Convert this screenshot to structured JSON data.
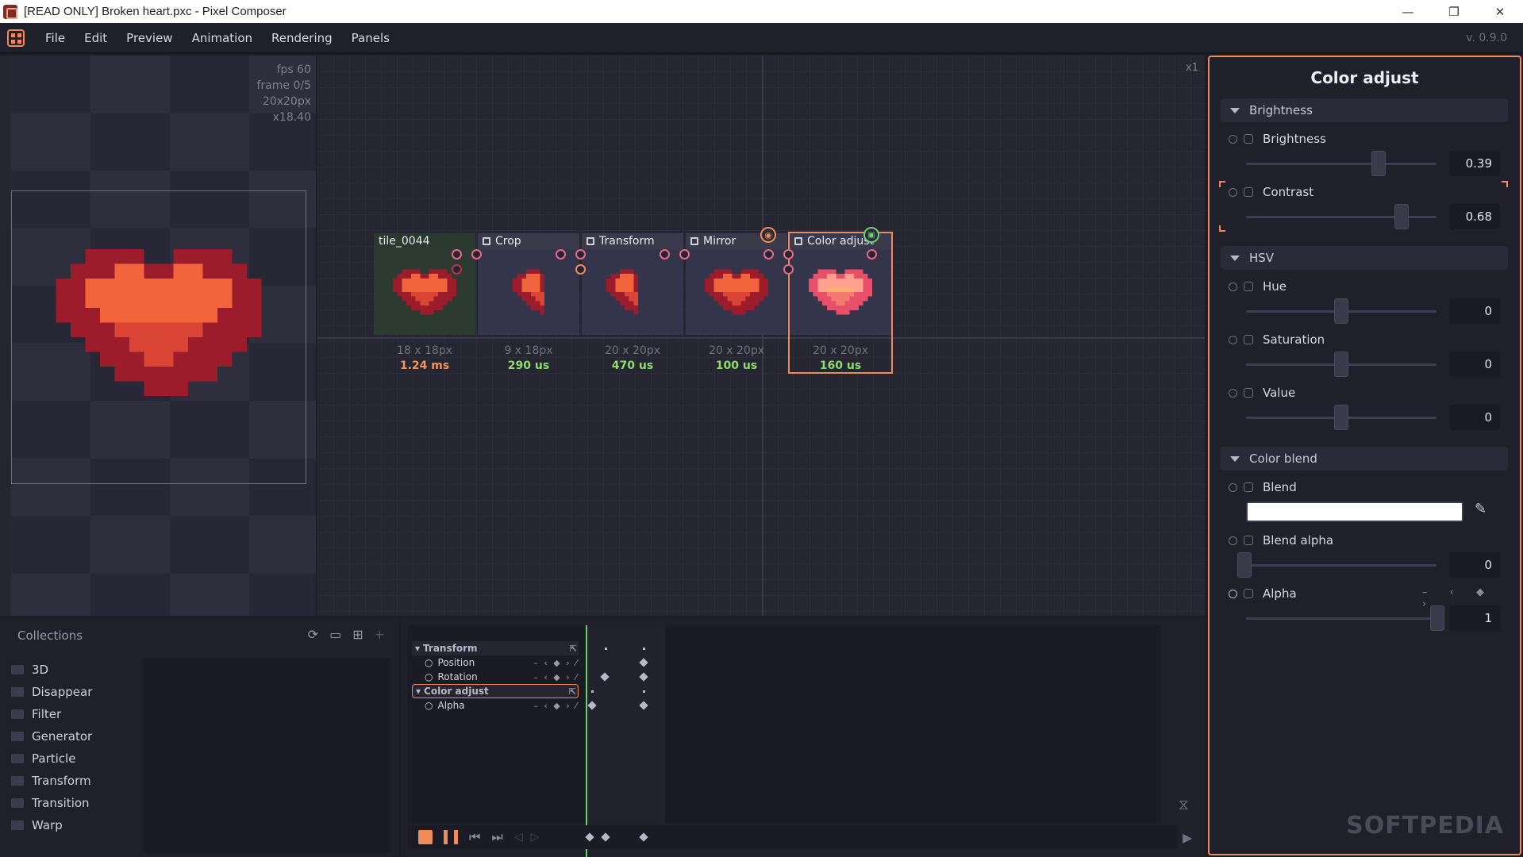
{
  "window": {
    "title": "[READ ONLY] Broken heart.pxc - Pixel Composer",
    "minimize": "—",
    "maximize": "❐",
    "close": "✕"
  },
  "menu": {
    "items": [
      "File",
      "Edit",
      "Preview",
      "Animation",
      "Rendering",
      "Panels"
    ],
    "version": "v. 0.9.0"
  },
  "preview": {
    "fps": "fps 60",
    "frame": "frame 0/5",
    "size": "20x20px",
    "zoom": "x18.40"
  },
  "graph": {
    "zoom": "x1",
    "nodes": [
      {
        "name": "tile_0044",
        "size": "18 x 18px",
        "time": "1.24 ms",
        "time_color": "#f2955a"
      },
      {
        "name": "Crop",
        "size": "9 x 18px",
        "time": "290 us",
        "time_color": "#8fdc6a"
      },
      {
        "name": "Transform",
        "size": "20 x 20px",
        "time": "470 us",
        "time_color": "#8fdc6a"
      },
      {
        "name": "Mirror",
        "size": "20 x 20px",
        "time": "100 us",
        "time_color": "#8fdc6a"
      },
      {
        "name": "Color adjust",
        "size": "20 x 20px",
        "time": "160 us",
        "time_color": "#8fdc6a"
      }
    ]
  },
  "collections": {
    "title": "Collections",
    "items": [
      "3D",
      "Disappear",
      "Filter",
      "Generator",
      "Particle",
      "Transform",
      "Transition",
      "Warp"
    ]
  },
  "timeline": {
    "rows": [
      {
        "label": "Transform",
        "type": "group"
      },
      {
        "label": "Position",
        "type": "prop"
      },
      {
        "label": "Rotation",
        "type": "prop"
      },
      {
        "label": "Color adjust",
        "type": "group"
      },
      {
        "label": "Alpha",
        "type": "prop"
      }
    ]
  },
  "inspector": {
    "title": "Color adjust",
    "sections": [
      "Brightness",
      "HSV",
      "Color blend"
    ],
    "props": {
      "brightness": {
        "label": "Brightness",
        "value": "0.39"
      },
      "contrast": {
        "label": "Contrast",
        "value": "0.68"
      },
      "hue": {
        "label": "Hue",
        "value": "0"
      },
      "saturation": {
        "label": "Saturation",
        "value": "0"
      },
      "value": {
        "label": "Value",
        "value": "0"
      },
      "blend": {
        "label": "Blend",
        "color": "#ffffff"
      },
      "blend_alpha": {
        "label": "Blend alpha",
        "value": "0"
      },
      "alpha": {
        "label": "Alpha",
        "value": "1"
      }
    },
    "watermark": "SOFTPEDIA"
  },
  "colors": {
    "accent": "#ef8a5a",
    "heart_dark": "#9c1c2c",
    "heart_light": "#f2643c",
    "heart_mid": "#d94434",
    "port": "#e86a8a",
    "green": "#6ad070"
  }
}
